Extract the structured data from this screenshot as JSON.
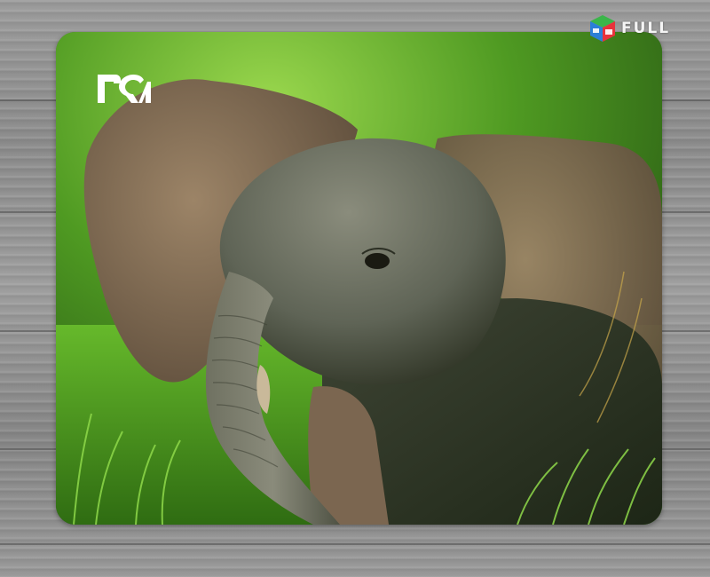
{
  "watermark": {
    "text": "FULL",
    "icon": "isometric-cube-icon",
    "colors": {
      "red": "#e8323c",
      "blue": "#2b7fd8",
      "green": "#3bb54a",
      "white": "#ffffff"
    }
  },
  "mousepad": {
    "logo_icon": "rsa-logo-icon",
    "subject": "elephant-calf",
    "colors": {
      "grass": "#4d9a1c",
      "bright_grass": "#7ed13a",
      "elephant": "#6e6a5d",
      "ear": "#8b7158",
      "background": "#9a9a9a"
    }
  }
}
